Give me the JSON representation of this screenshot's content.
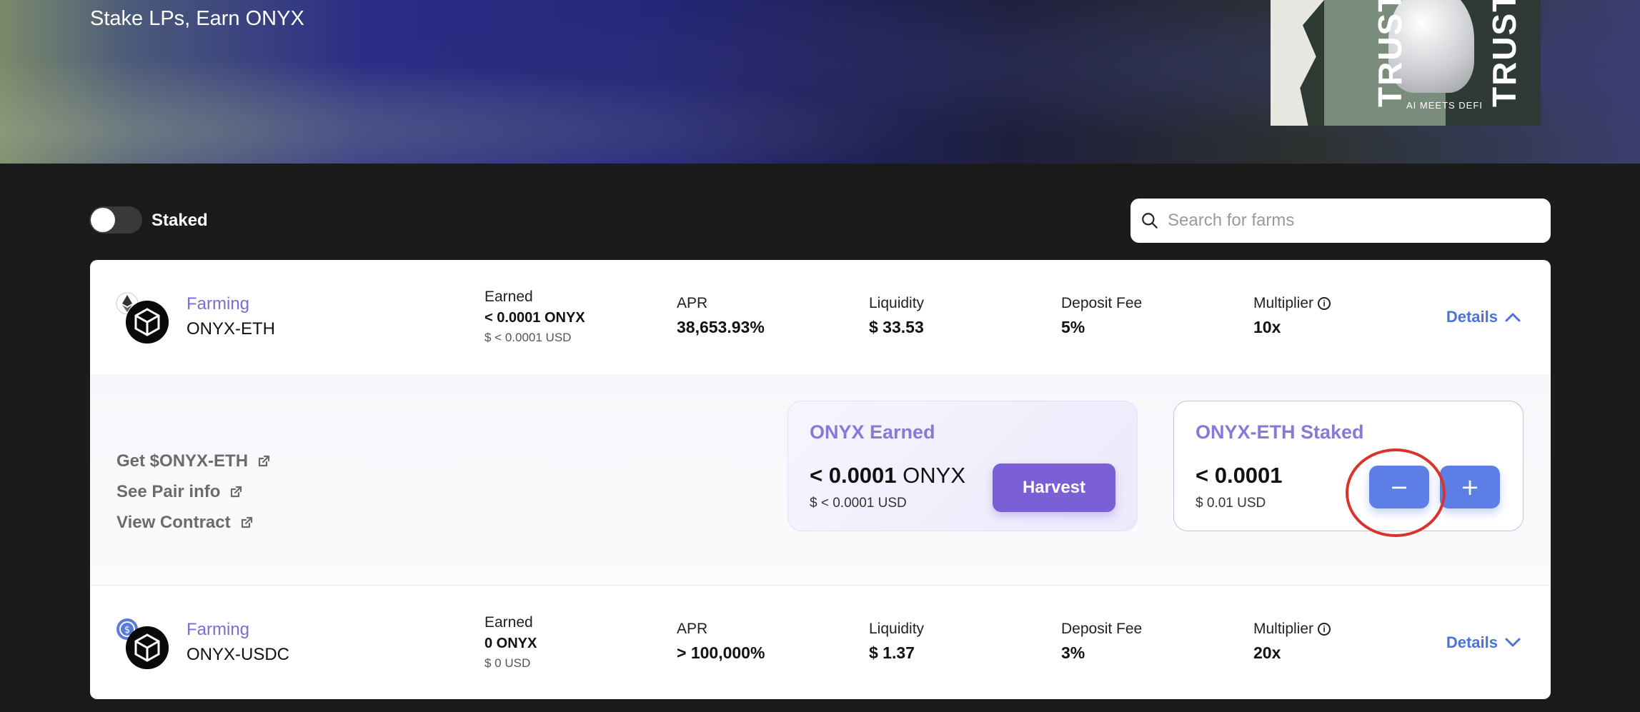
{
  "hero": {
    "title": "Stake LPs, Earn ONYX",
    "banner_word": "TRUST",
    "banner_tag": "AI MEETS DEFI"
  },
  "filters": {
    "staked_label": "Staked",
    "search_placeholder": "Search for farms"
  },
  "farms": [
    {
      "type": "Farming",
      "pair": "ONYX-ETH",
      "earned_label": "Earned",
      "earned_value": "< 0.0001 ONYX",
      "earned_usd": "$ < 0.0001 USD",
      "apr_label": "APR",
      "apr_value": "38,653.93%",
      "liquidity_label": "Liquidity",
      "liquidity_value": "$ 33.53",
      "fee_label": "Deposit Fee",
      "fee_value": "5%",
      "multiplier_label": "Multiplier",
      "multiplier_value": "10x",
      "details_label": "Details",
      "expanded": true
    },
    {
      "type": "Farming",
      "pair": "ONYX-USDC",
      "earned_label": "Earned",
      "earned_value": "0 ONYX",
      "earned_usd": "$ 0 USD",
      "apr_label": "APR",
      "apr_value": "> 100,000%",
      "liquidity_label": "Liquidity",
      "liquidity_value": "$ 1.37",
      "fee_label": "Deposit Fee",
      "fee_value": "3%",
      "multiplier_label": "Multiplier",
      "multiplier_value": "20x",
      "details_label": "Details",
      "expanded": false
    }
  ],
  "expanded_panel": {
    "links": [
      "Get $ONYX-ETH",
      "See Pair info",
      "View Contract"
    ],
    "earned_box": {
      "title": "ONYX Earned",
      "amount": "< 0.0001",
      "unit": "ONYX",
      "usd": "$ < 0.0001 USD",
      "button": "Harvest"
    },
    "staked_box": {
      "title": "ONYX-ETH Staked",
      "amount": "< 0.0001",
      "usd": "$ 0.01 USD",
      "minus": "−",
      "plus": "+"
    }
  },
  "colors": {
    "accent_purple": "#7b5fd4",
    "accent_blue": "#5d7ee4",
    "link_blue": "#4d72d8",
    "highlight_red": "#d9342b"
  }
}
